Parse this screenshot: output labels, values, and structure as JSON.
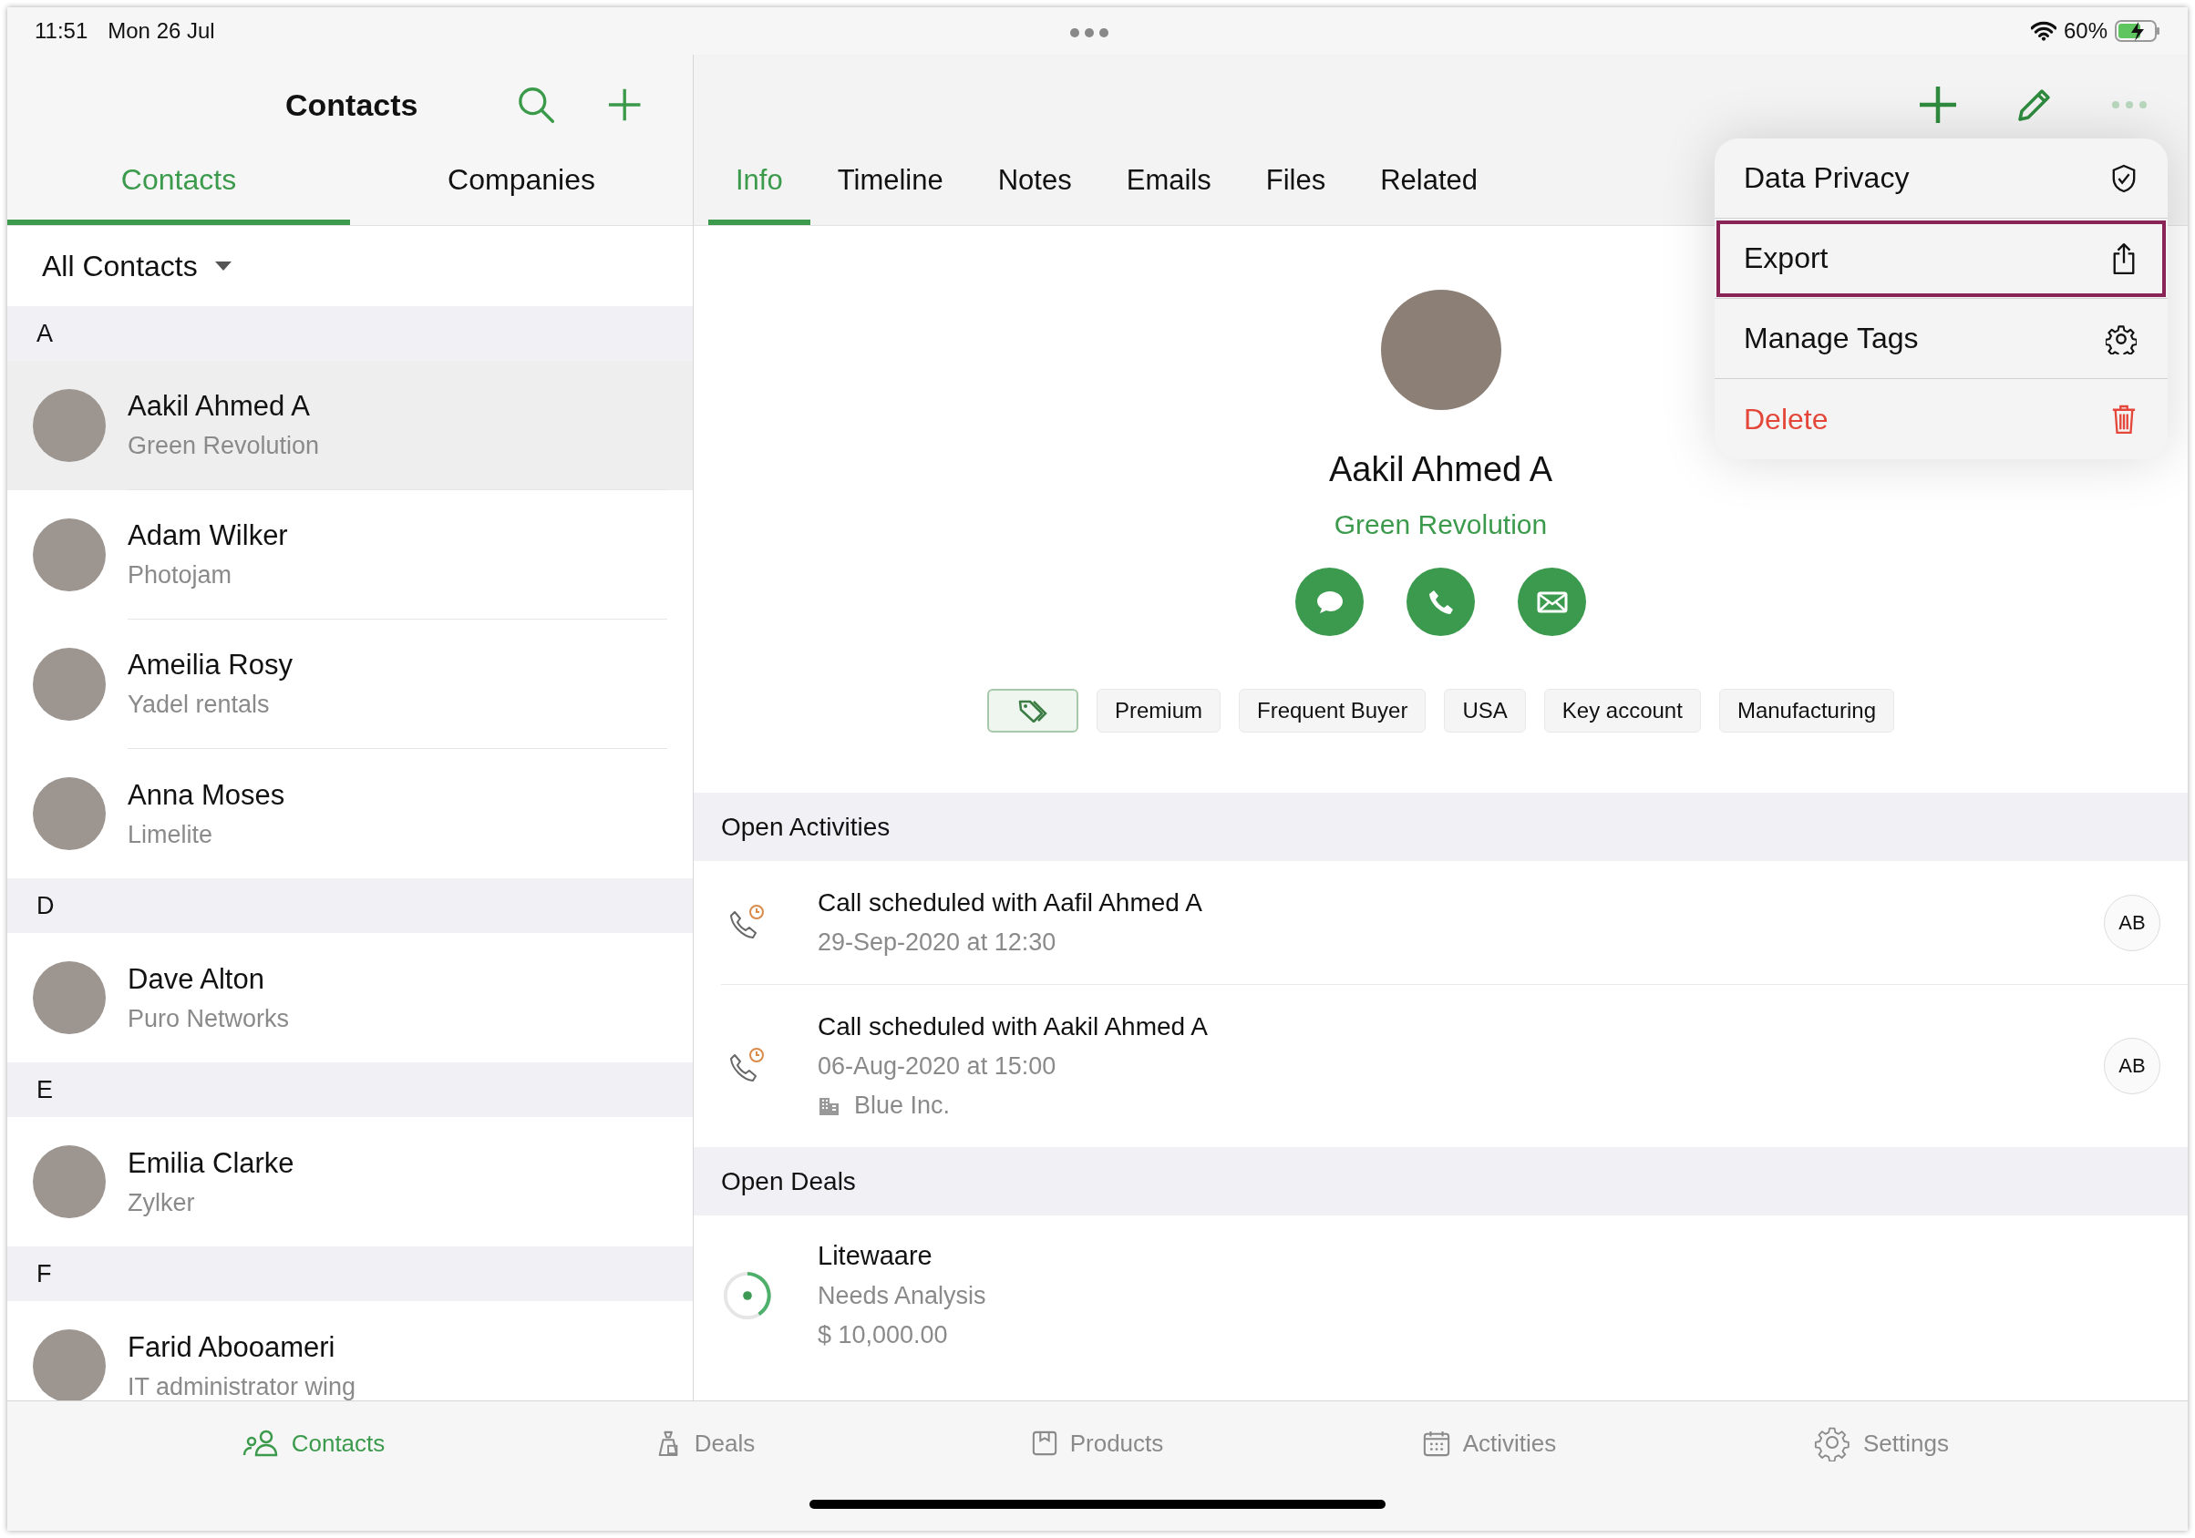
{
  "status_bar": {
    "time": "11:51",
    "date": "Mon 26 Jul",
    "battery": "60%"
  },
  "list_header": {
    "title": "Contacts"
  },
  "list_tabs": [
    {
      "label": "Contacts",
      "selected": true
    },
    {
      "label": "Companies",
      "selected": false
    }
  ],
  "filter": {
    "label": "All Contacts"
  },
  "contact_groups": [
    {
      "letter": "A",
      "contacts": [
        {
          "name": "Aakil Ahmed A",
          "company": "Green Revolution",
          "selected": true
        },
        {
          "name": "Adam Wilker",
          "company": "Photojam",
          "selected": false
        },
        {
          "name": "Ameilia Rosy",
          "company": "Yadel rentals",
          "selected": false
        },
        {
          "name": "Anna Moses",
          "company": "Limelite",
          "selected": false
        }
      ]
    },
    {
      "letter": "D",
      "contacts": [
        {
          "name": "Dave Alton",
          "company": "Puro Networks",
          "selected": false
        }
      ]
    },
    {
      "letter": "E",
      "contacts": [
        {
          "name": "Emilia Clarke",
          "company": "Zylker",
          "selected": false
        }
      ]
    },
    {
      "letter": "F",
      "contacts": [
        {
          "name": "Farid Abooameri",
          "company": "IT administrator wing",
          "selected": false
        }
      ]
    }
  ],
  "detail_tabs": [
    {
      "label": "Info",
      "selected": true
    },
    {
      "label": "Timeline",
      "selected": false
    },
    {
      "label": "Notes",
      "selected": false
    },
    {
      "label": "Emails",
      "selected": false
    },
    {
      "label": "Files",
      "selected": false
    },
    {
      "label": "Related",
      "selected": false
    }
  ],
  "menu": [
    {
      "label": "Data Privacy",
      "kind": "privacy",
      "highlighted": false
    },
    {
      "label": "Export",
      "kind": "export",
      "highlighted": true
    },
    {
      "label": "Manage Tags",
      "kind": "tags",
      "highlighted": false
    },
    {
      "label": "Delete",
      "kind": "delete",
      "highlighted": false
    }
  ],
  "contact": {
    "name": "Aakil Ahmed A",
    "company": "Green Revolution",
    "tags": [
      "Premium",
      "Frequent Buyer",
      "USA",
      "Key account",
      "Manufacturing"
    ]
  },
  "open_activities": {
    "title": "Open Activities",
    "items": [
      {
        "title": "Call scheduled with Aafil Ahmed A",
        "time": "29-Sep-2020 at 12:30",
        "owner": "AB"
      },
      {
        "title": "Call scheduled with Aakil Ahmed A",
        "time": "06-Aug-2020 at 15:00",
        "company": "Blue Inc.",
        "owner": "AB"
      }
    ]
  },
  "open_deals": {
    "title": "Open Deals",
    "items": [
      {
        "name": "Litewaare",
        "stage": "Needs Analysis",
        "amount": "$ 10,000.00"
      }
    ]
  },
  "tab_bar": [
    {
      "label": "Contacts",
      "kind": "contacts",
      "selected": true
    },
    {
      "label": "Deals",
      "kind": "deals",
      "selected": false
    },
    {
      "label": "Products",
      "kind": "products",
      "selected": false
    },
    {
      "label": "Activities",
      "kind": "activities",
      "selected": false
    },
    {
      "label": "Settings",
      "kind": "settings",
      "selected": false
    }
  ]
}
